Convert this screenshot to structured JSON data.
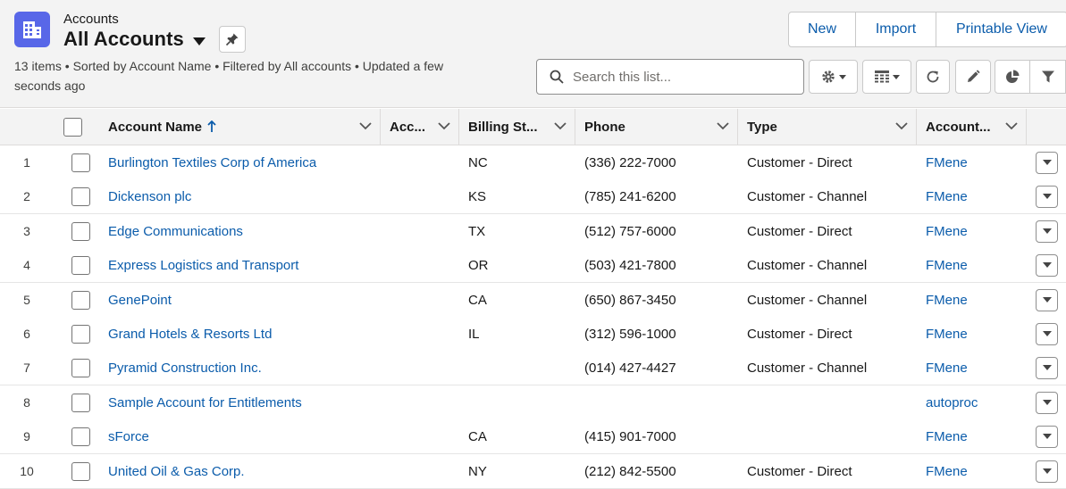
{
  "header": {
    "object_label": "Accounts",
    "list_title": "All Accounts",
    "meta_line1": "13 items • Sorted by Account Name • Filtered by All accounts • Updated a few",
    "meta_line2": "seconds ago",
    "buttons": [
      {
        "label": "New"
      },
      {
        "label": "Import"
      },
      {
        "label": "Printable View"
      }
    ],
    "search_placeholder": "Search this list...",
    "accent_color": "#5867e8",
    "link_color": "#0b5cab"
  },
  "table": {
    "columns": [
      {
        "label": "Account Name",
        "sorted": "ascending"
      },
      {
        "label": "Acc..."
      },
      {
        "label": "Billing St..."
      },
      {
        "label": "Phone"
      },
      {
        "label": "Type"
      },
      {
        "label": "Account..."
      }
    ],
    "rows": [
      {
        "num": "1",
        "name": "Burlington Textiles Corp of America",
        "state": "NC",
        "phone": "(336) 222-7000",
        "type": "Customer - Direct",
        "owner": "FMene"
      },
      {
        "num": "2",
        "name": "Dickenson plc",
        "state": "KS",
        "phone": "(785) 241-6200",
        "type": "Customer - Channel",
        "owner": "FMene"
      },
      {
        "num": "3",
        "name": "Edge Communications",
        "state": "TX",
        "phone": "(512) 757-6000",
        "type": "Customer - Direct",
        "owner": "FMene"
      },
      {
        "num": "4",
        "name": "Express Logistics and Transport",
        "state": "OR",
        "phone": "(503) 421-7800",
        "type": "Customer - Channel",
        "owner": "FMene"
      },
      {
        "num": "5",
        "name": "GenePoint",
        "state": "CA",
        "phone": "(650) 867-3450",
        "type": "Customer - Channel",
        "owner": "FMene"
      },
      {
        "num": "6",
        "name": "Grand Hotels & Resorts Ltd",
        "state": "IL",
        "phone": "(312) 596-1000",
        "type": "Customer - Direct",
        "owner": "FMene"
      },
      {
        "num": "7",
        "name": "Pyramid Construction Inc.",
        "state": "",
        "phone": "(014) 427-4427",
        "type": "Customer - Channel",
        "owner": "FMene"
      },
      {
        "num": "8",
        "name": "Sample Account for Entitlements",
        "state": "",
        "phone": "",
        "type": "",
        "owner": "autoproc"
      },
      {
        "num": "9",
        "name": "sForce",
        "state": "CA",
        "phone": "(415) 901-7000",
        "type": "",
        "owner": "FMene"
      },
      {
        "num": "10",
        "name": "United Oil & Gas Corp.",
        "state": "NY",
        "phone": "(212) 842-5500",
        "type": "Customer - Direct",
        "owner": "FMene"
      }
    ]
  }
}
